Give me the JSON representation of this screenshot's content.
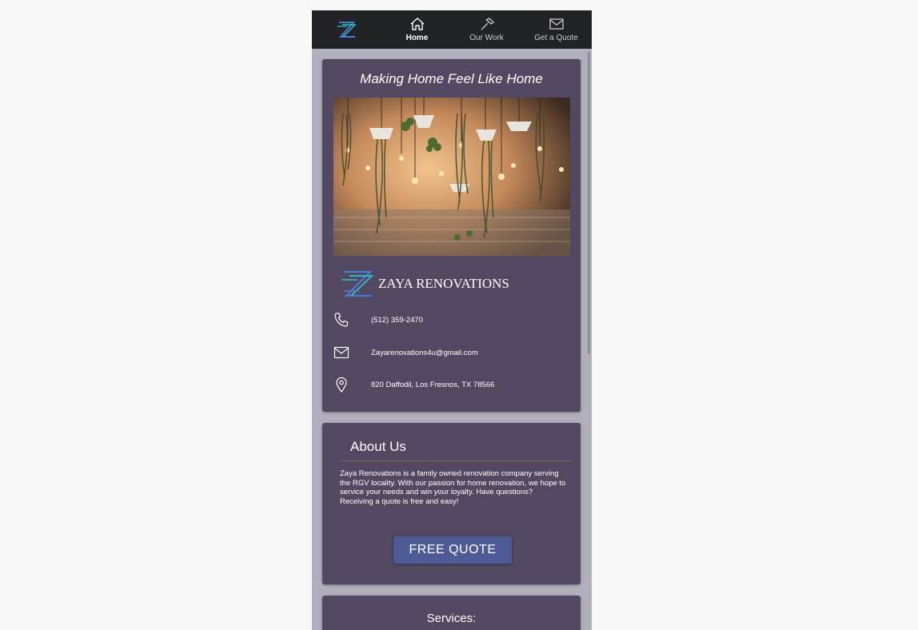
{
  "nav": {
    "tabs": [
      {
        "label": "Home",
        "icon": "home-icon",
        "active": true
      },
      {
        "label": "Our Work",
        "icon": "hammer-icon",
        "active": false
      },
      {
        "label": "Get a Quote",
        "icon": "mail-icon",
        "active": false
      }
    ]
  },
  "hero": {
    "tagline": "Making Home Feel Like Home",
    "brand_name": "ZAYA RENOVATIONS"
  },
  "contact": {
    "phone": "(512) 359-2470",
    "email": "Zayarenovations4u@gmail.com",
    "address": "820 Daffodil, Los Fresnos, TX 78566"
  },
  "about": {
    "title": "About Us",
    "text": "Zaya Renovations is a family owned renovation company serving the RGV locality. With our passion for home renovation, we hope to service your needs and win your loyalty. Have questions? Receiving a quote is free and easy!",
    "button_label": "FREE QUOTE"
  },
  "services": {
    "title": "Services:"
  },
  "colors": {
    "nav_bg": "#212326",
    "card_bg": "#524862",
    "page_bg": "#b0afbb",
    "button_bg": "#4e5a96",
    "logo_blue": "#4a7bd6",
    "logo_teal": "#2ec4c4"
  }
}
